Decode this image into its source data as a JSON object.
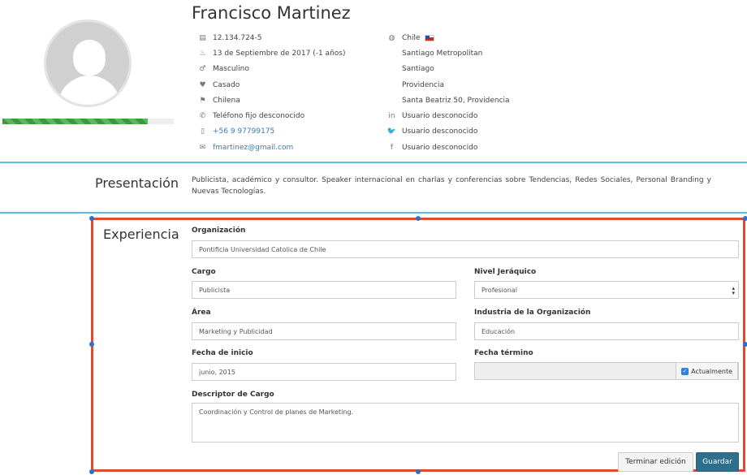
{
  "profile": {
    "name": "Francisco Martinez",
    "completion_fraction": 0.85,
    "left_info": [
      {
        "icon": "id-card-icon",
        "glyph": "▤",
        "text": "12.134.724-5",
        "link": false
      },
      {
        "icon": "birthday-cake-icon",
        "glyph": "♨",
        "text": "13 de Septiembre de 2017 (-1 años)",
        "link": false
      },
      {
        "icon": "gender-icon",
        "glyph": "♂",
        "text": "Masculino",
        "link": false
      },
      {
        "icon": "heart-icon",
        "glyph": "♥",
        "text": "Casado",
        "link": false
      },
      {
        "icon": "flag-icon",
        "glyph": "⚑",
        "text": "Chilena",
        "link": false
      },
      {
        "icon": "phone-icon",
        "glyph": "✆",
        "text": "Teléfono fijo desconocido",
        "link": false
      },
      {
        "icon": "mobile-icon",
        "glyph": "▯",
        "text": "+56 9 97799175",
        "link": true
      },
      {
        "icon": "envelope-icon",
        "glyph": "✉",
        "text": "fmartinez@gmail.com",
        "link": true
      }
    ],
    "right_info": [
      {
        "icon": "globe-icon",
        "glyph": "◍",
        "text": "Chile",
        "flag": true
      },
      {
        "icon": "",
        "glyph": "",
        "text": "Santiago Metropolitan"
      },
      {
        "icon": "",
        "glyph": "",
        "text": "Santiago"
      },
      {
        "icon": "",
        "glyph": "",
        "text": "Providencia"
      },
      {
        "icon": "",
        "glyph": "",
        "text": "Santa Beatriz 50, Providencia"
      },
      {
        "icon": "linkedin-icon",
        "glyph": "in",
        "text": "Usuario desconocido"
      },
      {
        "icon": "twitter-icon",
        "glyph": "🐦",
        "text": "Usuario desconocido"
      },
      {
        "icon": "facebook-icon",
        "glyph": "f",
        "text": "Usuario desconocido"
      }
    ]
  },
  "presentacion": {
    "title": "Presentación",
    "text": "Publicista, académico y consultor. Speaker internacional en charlas y conferencias sobre Tendencias, Redes Sociales, Personal Branding y Nuevas Tecnologías."
  },
  "experiencia": {
    "title": "Experiencia",
    "organizacion_label": "Organización",
    "organizacion_value": "Pontificia Universidad Catolica de Chile",
    "cargo_label": "Cargo",
    "cargo_value": "Publicista",
    "nivel_label": "Nivel Jeráquico",
    "nivel_value": "Profesional",
    "area_label": "Área",
    "area_value": "Marketing y Publicidad",
    "industria_label": "Industria de la Organización",
    "industria_value": "Educación",
    "inicio_label": "Fecha de inicio",
    "inicio_value": "junio, 2015",
    "termino_label": "Fecha término",
    "termino_value": "",
    "actualmente_label": "Actualmente",
    "actualmente_checked": true,
    "descriptor_label": "Descriptor de Cargo",
    "descriptor_value": "Coordinación y Control de planes de Marketing.",
    "cancel_label": "Terminar edición",
    "save_label": "Guardar"
  },
  "colors": {
    "accent_divider": "#5bc0de",
    "selection_frame": "#e04b2c",
    "primary_button": "#2f6f8e",
    "progress": "#5cb85c"
  }
}
